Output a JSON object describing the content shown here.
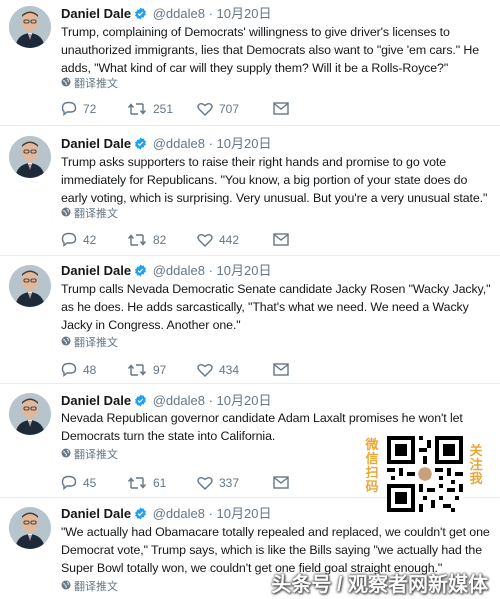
{
  "tweets": [
    {
      "name": "Daniel Dale",
      "handle": "@ddale8",
      "date": "· 10月20日",
      "text": "Trump, complaining of Democrats' willingness to give driver's licenses to unauthorized immigrants, lies that Democrats also want to \"give 'em cars.\" He adds, \"What kind of car will they supply them? Will it be a Rolls-Royce?\"",
      "translate": "翻译推文",
      "replies": "72",
      "retweets": "251",
      "likes": "707"
    },
    {
      "name": "Daniel Dale",
      "handle": "@ddale8",
      "date": "· 10月20日",
      "text": "Trump asks supporters to raise their right hands and promise to go vote immediately for Republicans. \"You know, a big portion of your state does do early voting, which is surprising. Very unusual. But you're a very unusual state.\"",
      "translate": "翻译推文",
      "replies": "42",
      "retweets": "82",
      "likes": "442"
    },
    {
      "name": "Daniel Dale",
      "handle": "@ddale8",
      "date": "· 10月20日",
      "text": "Trump calls Nevada Democratic Senate candidate Jacky Rosen \"Wacky Jacky,\" as he does. He adds sarcastically, \"That's what we need. We need a Wacky Jacky in Congress. Another one.\"",
      "translate": "翻译推文",
      "replies": "48",
      "retweets": "97",
      "likes": "434"
    },
    {
      "name": "Daniel Dale",
      "handle": "@ddale8",
      "date": "· 10月20日",
      "text": "Nevada Republican governor candidate Adam Laxalt promises he won't let Democrats turn the state into California.",
      "translate": "翻译推文",
      "replies": "45",
      "retweets": "61",
      "likes": "337"
    },
    {
      "name": "Daniel Dale",
      "handle": "@ddale8",
      "date": "· 10月20日",
      "text": "\"We actually had Obamacare totally repealed and replaced, we couldn't get one Democrat vote,\" Trump says, which is like the Bills saying \"we actually had the Super Bowl totally won, we couldn't get one field goal straight enough.\"",
      "translate": "翻译推文"
    }
  ],
  "qr": {
    "left_text": "微信扫码",
    "right_text": "关注我"
  },
  "watermark": "头条号 / 观察者网新媒体",
  "colors": {
    "text": "#14171a",
    "secondary": "#657786",
    "verified": "#1da1f2",
    "divider": "#e6ecf0",
    "qr_text": "#e8a83a"
  },
  "icons": [
    "reply-icon",
    "retweet-icon",
    "like-icon",
    "message-icon",
    "globe-icon",
    "verified-badge-icon"
  ]
}
